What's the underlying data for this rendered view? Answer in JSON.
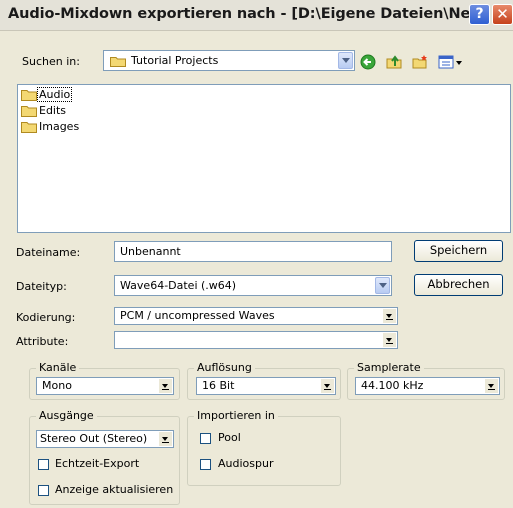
{
  "window": {
    "title": "Audio-Mixdown exportieren nach - [D:\\Eigene Dateien\\Ne...",
    "help": "?",
    "close": "✕"
  },
  "lookin": {
    "label": "Suchen in:",
    "value": "Tutorial Projects"
  },
  "toolbar": {
    "icons": [
      "back-icon",
      "up-folder-icon",
      "new-folder-icon",
      "view-menu-icon"
    ]
  },
  "files": [
    {
      "name": "Audio"
    },
    {
      "name": "Edits"
    },
    {
      "name": "Images"
    }
  ],
  "filename": {
    "label": "Dateiname:",
    "value": "Unbenannt"
  },
  "filetype": {
    "label": "Dateityp:",
    "value": "Wave64-Datei (.w64)"
  },
  "buttons": {
    "save": "Speichern",
    "cancel": "Abbrechen"
  },
  "encoding": {
    "label": "Kodierung:",
    "value": "PCM / uncompressed Waves"
  },
  "attributes": {
    "label": "Attribute:",
    "value": ""
  },
  "channels": {
    "label": "Kanäle",
    "value": "Mono"
  },
  "resolution": {
    "label": "Auflösung",
    "value": "16 Bit"
  },
  "samplerate": {
    "label": "Samplerate",
    "value": "44.100 kHz"
  },
  "outputs": {
    "label": "Ausgänge",
    "value": "Stereo Out (Stereo)",
    "realtime": "Echtzeit-Export",
    "update": "Anzeige aktualisieren"
  },
  "import": {
    "label": "Importieren in",
    "pool": "Pool",
    "track": "Audiospur"
  },
  "colors": {
    "titlebar": "#e4e2d8",
    "dialog": "#ece9d8",
    "field_border": "#7f9db9",
    "folder": "#f3d873"
  }
}
